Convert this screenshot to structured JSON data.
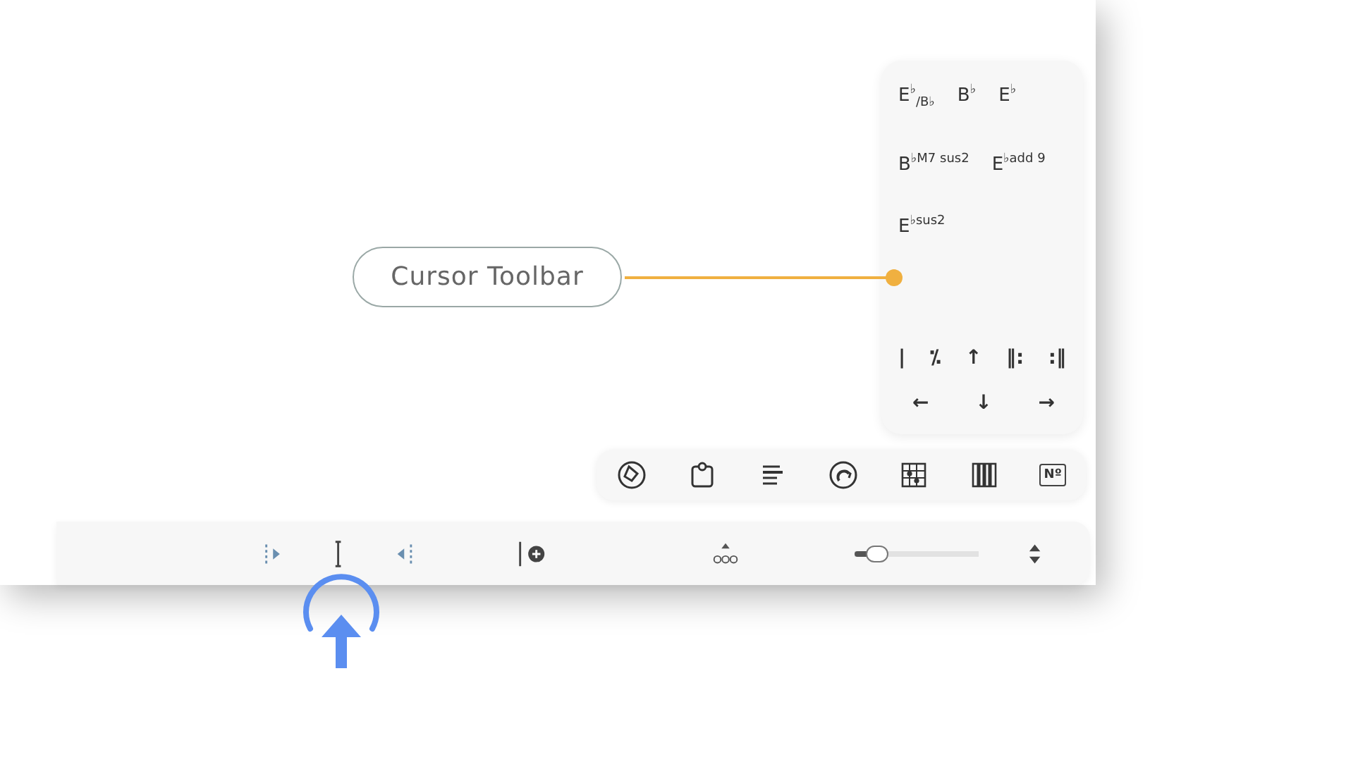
{
  "chord_panel": {
    "chords": [
      {
        "label": "E$^{♭}$$_{/B♭}$"
      },
      {
        "label": "B$^{♭}$"
      },
      {
        "label": "E$^{♭}$"
      },
      {
        "label": "B$^{♭M7 sus2}$"
      },
      {
        "label": "E$^{♭add 9}$"
      },
      {
        "label": "E$^{♭sus2}$"
      }
    ],
    "symbols": [
      "|",
      "⁒",
      "↑",
      "‖:",
      ":‖"
    ],
    "arrows": [
      "←",
      "↓",
      "→"
    ]
  },
  "tool_bar": {
    "number_label": "Nº"
  },
  "cursor_bar": {
    "zoom_slider": {
      "level": 0.17
    }
  },
  "callout": {
    "label": "Cursor Toolbar"
  }
}
